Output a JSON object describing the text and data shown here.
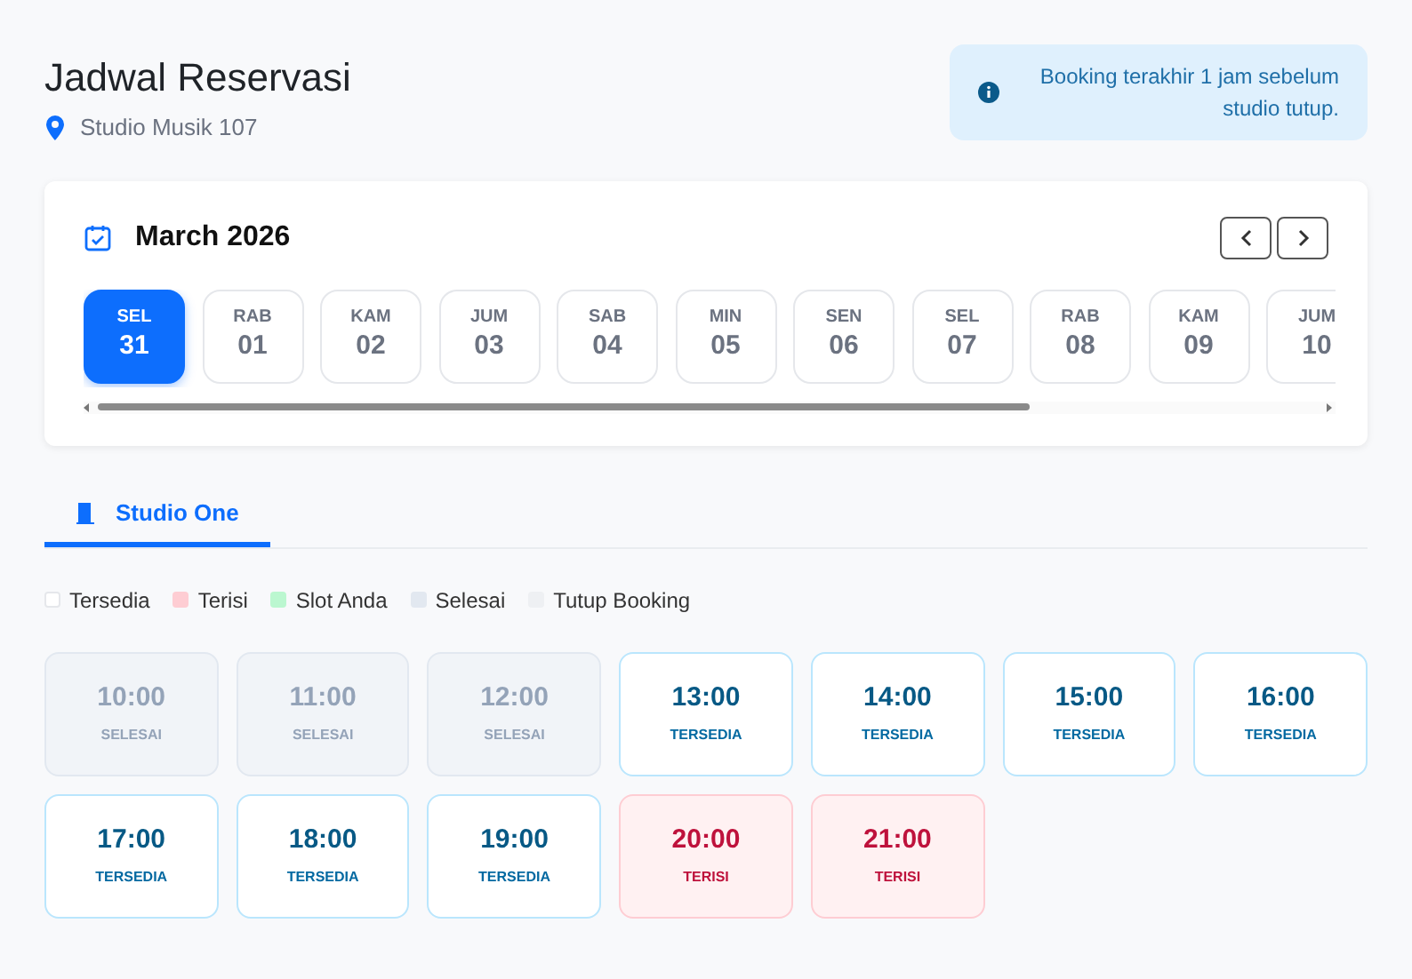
{
  "header": {
    "title": "Jadwal Reservasi",
    "location": "Studio Musik 107"
  },
  "notice": {
    "text": "Booking terakhir 1 jam sebelum studio tutup."
  },
  "calendar": {
    "month": "March 2026",
    "days": [
      {
        "weekday": "SEL",
        "date": "31",
        "selected": true
      },
      {
        "weekday": "RAB",
        "date": "01",
        "selected": false
      },
      {
        "weekday": "KAM",
        "date": "02",
        "selected": false
      },
      {
        "weekday": "JUM",
        "date": "03",
        "selected": false
      },
      {
        "weekday": "SAB",
        "date": "04",
        "selected": false
      },
      {
        "weekday": "MIN",
        "date": "05",
        "selected": false
      },
      {
        "weekday": "SEN",
        "date": "06",
        "selected": false
      },
      {
        "weekday": "SEL",
        "date": "07",
        "selected": false
      },
      {
        "weekday": "RAB",
        "date": "08",
        "selected": false
      },
      {
        "weekday": "KAM",
        "date": "09",
        "selected": false
      },
      {
        "weekday": "JUM",
        "date": "10",
        "selected": false
      }
    ]
  },
  "tabs": [
    {
      "label": "Studio One",
      "selected": true
    }
  ],
  "legend": [
    {
      "label": "Tersedia",
      "color": "#ffffff"
    },
    {
      "label": "Terisi",
      "color": "#fecdd3"
    },
    {
      "label": "Slot Anda",
      "color": "#bbf7d0"
    },
    {
      "label": "Selesai",
      "color": "#e2e8f0"
    },
    {
      "label": "Tutup Booking",
      "color": "#eef0f3"
    }
  ],
  "slots": [
    {
      "time": "10:00",
      "status": "SELESAI",
      "kind": "done"
    },
    {
      "time": "11:00",
      "status": "SELESAI",
      "kind": "done"
    },
    {
      "time": "12:00",
      "status": "SELESAI",
      "kind": "done"
    },
    {
      "time": "13:00",
      "status": "TERSEDIA",
      "kind": "available"
    },
    {
      "time": "14:00",
      "status": "TERSEDIA",
      "kind": "available"
    },
    {
      "time": "15:00",
      "status": "TERSEDIA",
      "kind": "available"
    },
    {
      "time": "16:00",
      "status": "TERSEDIA",
      "kind": "available"
    },
    {
      "time": "17:00",
      "status": "TERSEDIA",
      "kind": "available"
    },
    {
      "time": "18:00",
      "status": "TERSEDIA",
      "kind": "available"
    },
    {
      "time": "19:00",
      "status": "TERSEDIA",
      "kind": "available"
    },
    {
      "time": "20:00",
      "status": "TERISI",
      "kind": "booked"
    },
    {
      "time": "21:00",
      "status": "TERISI",
      "kind": "booked"
    }
  ]
}
